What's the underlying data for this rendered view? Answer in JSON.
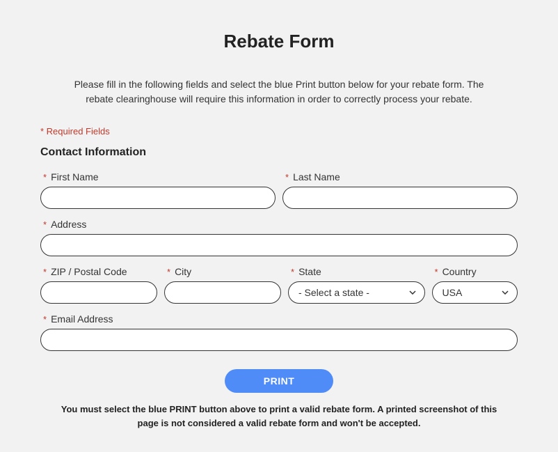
{
  "title": "Rebate Form",
  "intro": "Please fill in the following fields and select the blue Print button below for your rebate form. The rebate clearinghouse will require this information in order to correctly process your rebate.",
  "requiredFields": "* Required Fields",
  "sectionHeading": "Contact Information",
  "fields": {
    "firstName": {
      "label": "First Name",
      "value": ""
    },
    "lastName": {
      "label": "Last Name",
      "value": ""
    },
    "address": {
      "label": "Address",
      "value": ""
    },
    "zip": {
      "label": "ZIP / Postal Code",
      "value": ""
    },
    "city": {
      "label": "City",
      "value": ""
    },
    "state": {
      "label": "State",
      "placeholder": "- Select a state -",
      "value": ""
    },
    "country": {
      "label": "Country",
      "value": "USA"
    },
    "email": {
      "label": "Email Address",
      "value": ""
    }
  },
  "printButton": "PRINT",
  "footerNote": "You must select the blue PRINT button above to print a valid rebate form. A printed screenshot of this page is not considered a valid rebate form and won't be accepted."
}
